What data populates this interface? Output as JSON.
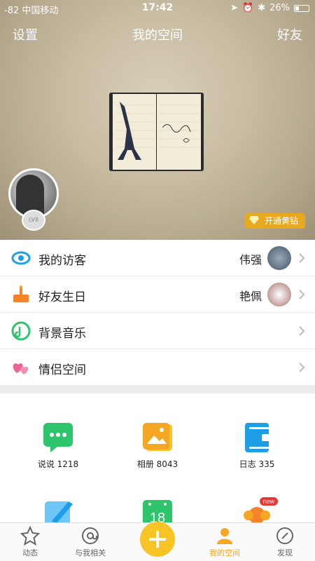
{
  "status_bar": {
    "signal": "-82 中国移动",
    "time": "17:42",
    "battery": "26%",
    "battery_level": 0.26
  },
  "header": {
    "left": "设置",
    "title": "我的空间",
    "right": "好友"
  },
  "profile": {
    "level": "LV8",
    "vip_button": "开通黄钻"
  },
  "list": [
    {
      "label": "我的访客",
      "value": "伟强",
      "icon": "eye-icon"
    },
    {
      "label": "好友生日",
      "value": "艳佩",
      "icon": "cake-icon"
    },
    {
      "label": "背景音乐",
      "value": "",
      "icon": "music-note-icon"
    },
    {
      "label": "情侣空间",
      "value": "",
      "icon": "hearts-icon"
    }
  ],
  "grid": [
    {
      "label": "说说 1218",
      "icon": "chat-bubble-icon"
    },
    {
      "label": "相册 8043",
      "icon": "photo-album-icon"
    },
    {
      "label": "日志 335",
      "icon": "journal-icon"
    },
    {
      "label": "",
      "icon": "pen-icon"
    },
    {
      "label": "18",
      "icon": "calendar-icon"
    },
    {
      "label": "new",
      "icon": "avatar-badge-icon"
    }
  ],
  "tabs": [
    {
      "label": "动态",
      "icon": "star-icon"
    },
    {
      "label": "与我相关",
      "icon": "at-icon"
    },
    {
      "label": "",
      "icon": "plus-icon"
    },
    {
      "label": "我的空间",
      "icon": "person-icon"
    },
    {
      "label": "发现",
      "icon": "compass-icon"
    }
  ],
  "colors": {
    "accent": "#f5a623",
    "plus": "#f7c325",
    "green": "#2ec46b",
    "blue": "#1f9ee8"
  }
}
